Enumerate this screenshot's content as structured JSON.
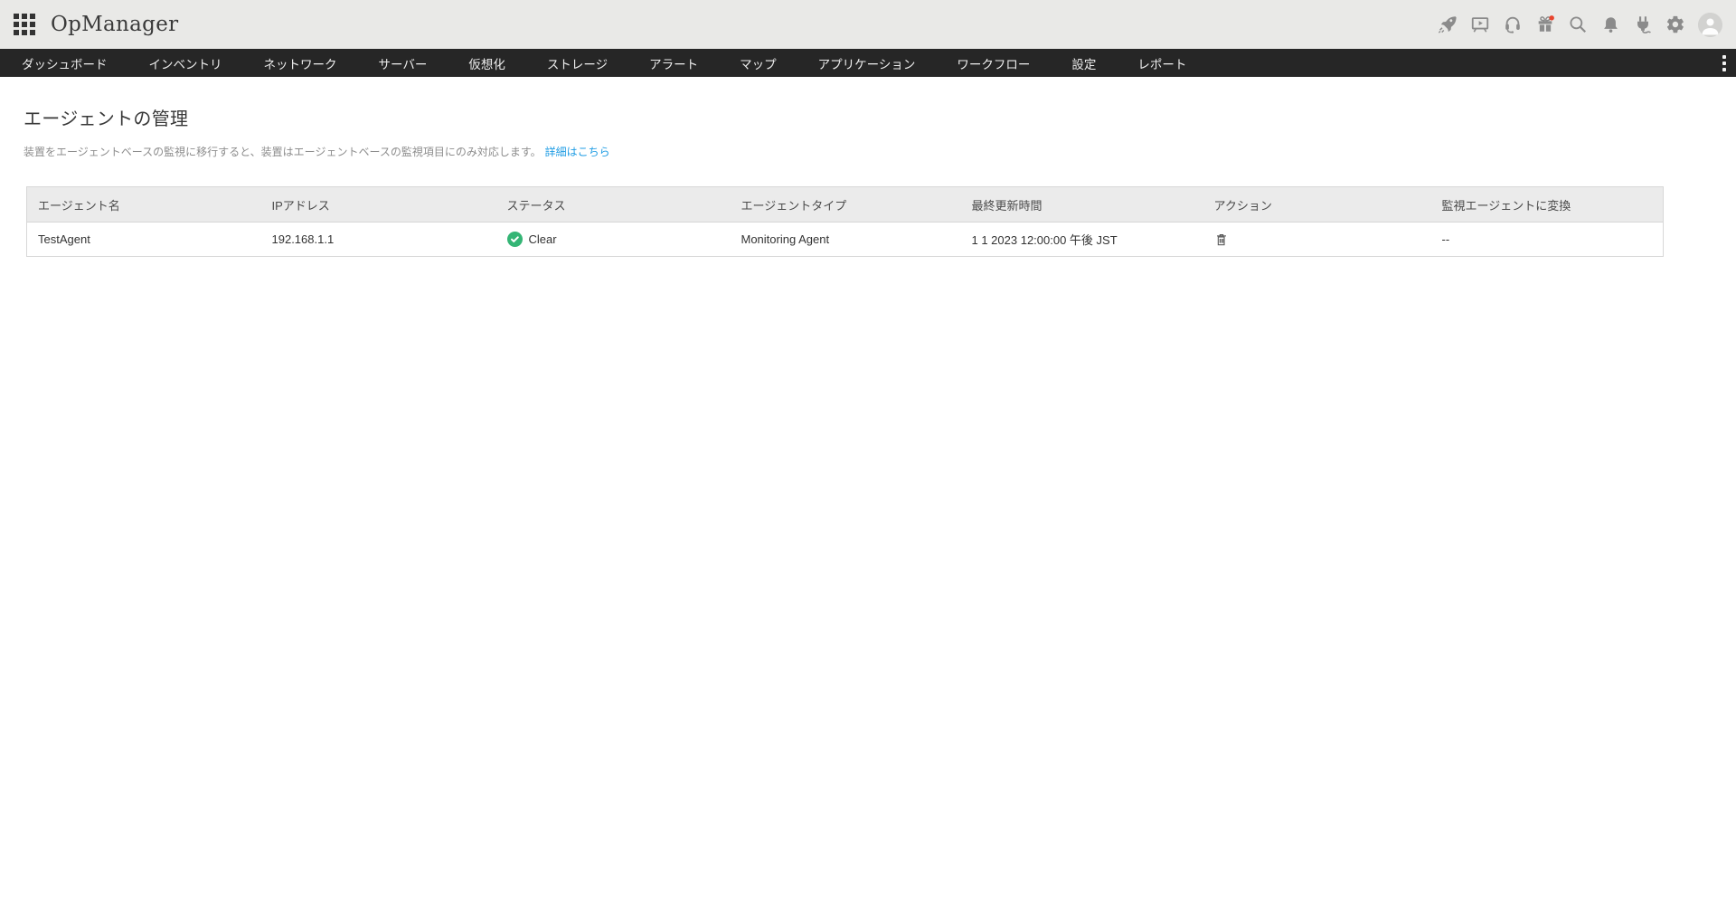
{
  "app": {
    "logo": "OpManager"
  },
  "topbar": {
    "icons": [
      "apps-grid-icon",
      "rocket-icon",
      "presentation-icon",
      "headset-icon",
      "gift-icon",
      "search-icon",
      "bell-icon",
      "plug-icon",
      "gear-icon",
      "avatar"
    ],
    "gift_badge_color": "#e8442e"
  },
  "nav": {
    "items": [
      {
        "label": "ダッシュボード"
      },
      {
        "label": "インベントリ"
      },
      {
        "label": "ネットワーク"
      },
      {
        "label": "サーバー"
      },
      {
        "label": "仮想化"
      },
      {
        "label": "ストレージ"
      },
      {
        "label": "アラート"
      },
      {
        "label": "マップ"
      },
      {
        "label": "アプリケーション"
      },
      {
        "label": "ワークフロー"
      },
      {
        "label": "設定"
      },
      {
        "label": "レポート"
      }
    ]
  },
  "page": {
    "title": "エージェントの管理",
    "description": "装置をエージェントベースの監視に移行すると、装置はエージェントベースの監視項目にのみ対応します。",
    "learn_more": "詳細はこちら"
  },
  "table": {
    "columns": [
      "エージェント名",
      "IPアドレス",
      "ステータス",
      "エージェントタイプ",
      "最終更新時間",
      "アクション",
      "監視エージェントに変換"
    ],
    "rows": [
      {
        "name": "TestAgent",
        "ip": "192.168.1.1",
        "status": "Clear",
        "type": "Monitoring Agent",
        "updated": "1 1 2023 12:00:00 午後 JST",
        "convert": "--"
      }
    ]
  },
  "colors": {
    "status_clear": "#34b575",
    "link": "#1e9ce4",
    "navbar_bg": "#262626",
    "topbar_bg": "#e9e9e7"
  }
}
